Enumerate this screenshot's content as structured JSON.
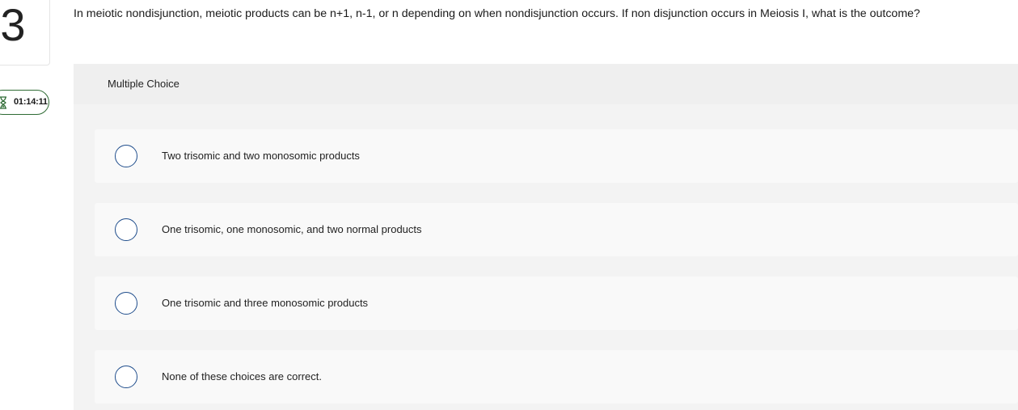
{
  "question_number": "3",
  "timer": {
    "icon": "hourglass-icon",
    "remaining": "01:14:11",
    "color": "#2e6b34"
  },
  "question_text": "In meiotic nondisjunction, meiotic products can be n+1, n-1, or n depending on when nondisjunction occurs. If non disjunction occurs in Meiosis I, what is the outcome?",
  "answer_panel": {
    "type_label": "Multiple Choice",
    "choices": [
      {
        "label": "Two trisomic and two monosomic products",
        "selected": false
      },
      {
        "label": "One trisomic, one monosomic, and two normal products",
        "selected": false
      },
      {
        "label": "One trisomic and three monosomic products",
        "selected": false
      },
      {
        "label": "None of these choices are correct.",
        "selected": false
      }
    ]
  },
  "colors": {
    "radio_border": "#1f4d8c",
    "panel_bg": "#f3f3f3",
    "choice_bg": "#f9f9f9"
  }
}
